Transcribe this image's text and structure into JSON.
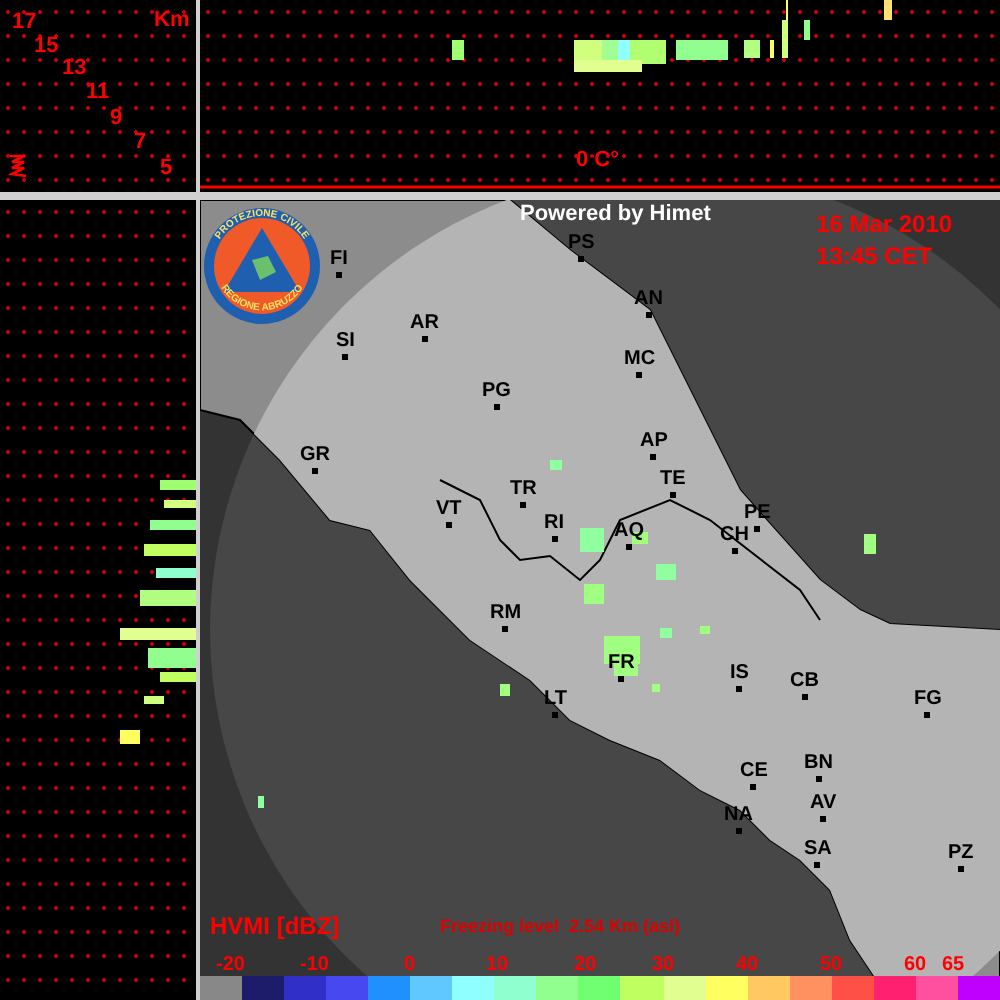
{
  "altitude_axis": {
    "labels": [
      "17",
      "15",
      "13",
      "11",
      "9",
      "7",
      "5"
    ],
    "unit": "Km"
  },
  "vertical_section": {
    "freezing_label": "0 C°"
  },
  "map": {
    "attribution": "Powered by Himet",
    "date": "16 Mar 2010",
    "time": "13:45 CET",
    "logo": {
      "top_text": "PROTEZIONE CIVILE",
      "bottom_text": "REGIONE ABRUZZO"
    },
    "cities": [
      {
        "label": "FI"
      },
      {
        "label": "SI"
      },
      {
        "label": "AR"
      },
      {
        "label": "PS"
      },
      {
        "label": "AN"
      },
      {
        "label": "MC"
      },
      {
        "label": "PG"
      },
      {
        "label": "GR"
      },
      {
        "label": "AP"
      },
      {
        "label": "TE"
      },
      {
        "label": "TR"
      },
      {
        "label": "VT"
      },
      {
        "label": "RI"
      },
      {
        "label": "AQ"
      },
      {
        "label": "PE"
      },
      {
        "label": "CH"
      },
      {
        "label": "RM"
      },
      {
        "label": "FR"
      },
      {
        "label": "IS"
      },
      {
        "label": "CB"
      },
      {
        "label": "FG"
      },
      {
        "label": "LT"
      },
      {
        "label": "CE"
      },
      {
        "label": "BN"
      },
      {
        "label": "AV"
      },
      {
        "label": "NA"
      },
      {
        "label": "SA"
      },
      {
        "label": "PZ"
      }
    ]
  },
  "legend": {
    "title": "HVMI [dBZ]",
    "freezing_level": "Freezing level  2.54 Km (asl)",
    "ticks": [
      "-20",
      "-10",
      "0",
      "10",
      "20",
      "30",
      "40",
      "50",
      "60",
      "65"
    ],
    "swatches": [
      {
        "color": "#888888"
      },
      {
        "color": "#1c1c6a"
      },
      {
        "color": "#3030c8"
      },
      {
        "color": "#4848f0"
      },
      {
        "color": "#2090ff"
      },
      {
        "color": "#60c8ff"
      },
      {
        "color": "#90ffff"
      },
      {
        "color": "#90ffd0"
      },
      {
        "color": "#90ff90"
      },
      {
        "color": "#70ff70"
      },
      {
        "color": "#c0ff60"
      },
      {
        "color": "#e0ff90"
      },
      {
        "color": "#ffff60"
      },
      {
        "color": "#ffc860"
      },
      {
        "color": "#ff9060"
      },
      {
        "color": "#ff5048"
      },
      {
        "color": "#ff2070"
      },
      {
        "color": "#ff50a0"
      },
      {
        "color": "#c000ff"
      }
    ]
  }
}
